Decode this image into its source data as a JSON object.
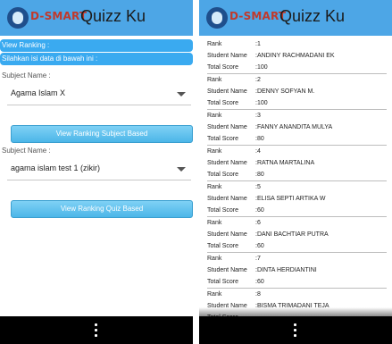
{
  "app": {
    "logo_text": "D-SMART",
    "title": "Quizz Ku"
  },
  "colors": {
    "appbar": "#4da6e6",
    "info_bar": "#3aaaf0",
    "button": "#4cb6e8",
    "navbar": "#000000"
  },
  "ranking_form": {
    "info_1": "View Ranking :",
    "info_2": "Silahkan isi data di bawah ini :",
    "subject_label_1": "Subject Name :",
    "subject_select_1": "Agama Islam X",
    "button_subject": "View Ranking Subject Based",
    "subject_label_2": "Subject Name :",
    "subject_select_2": "agama islam test 1 (zikir)",
    "button_quiz": "View Ranking Quiz Based"
  },
  "ranking_list": {
    "labels": {
      "rank": "Rank",
      "name": "Student Name",
      "score": "Total Score"
    },
    "entries": [
      {
        "rank": ":1",
        "name": ":ANDINY RACHMADANI EK",
        "score": ":100"
      },
      {
        "rank": ":2",
        "name": ":DENNY SOFYAN M.",
        "score": ":100"
      },
      {
        "rank": ":3",
        "name": ":FANNY ANANDITA MULYA",
        "score": ":80"
      },
      {
        "rank": ":4",
        "name": ":RATNA MARTALINA",
        "score": ":80"
      },
      {
        "rank": ":5",
        "name": ":ELISA SEPTI ARTIKA W",
        "score": ":60"
      },
      {
        "rank": ":6",
        "name": ":DANI BACHTIAR PUTRA",
        "score": ":60"
      },
      {
        "rank": ":7",
        "name": ":DINTA HERDIANTINI",
        "score": ":60"
      },
      {
        "rank": ":8",
        "name": ":BISMA TRIMADANI TEJA",
        "score": ""
      }
    ]
  },
  "icons": {
    "logo": "owl-logo-icon",
    "dropdown": "caret-down-icon",
    "menu": "overflow-menu-icon"
  }
}
